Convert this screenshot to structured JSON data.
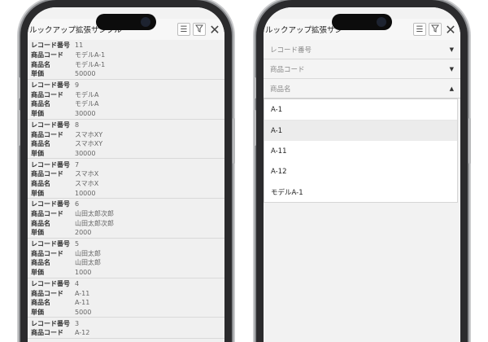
{
  "app": {
    "title": "ルックアップ拡張サンプル",
    "title_right": "ルックアップ拡張サン"
  },
  "toolbar": {
    "sort_icon": "sort-icon",
    "filter_icon": "filter-icon",
    "close_icon": "close-icon",
    "sort_glyph": "☰",
    "filter_glyph": "⏚",
    "close_glyph": "✕"
  },
  "labels": {
    "record_no": "レコード番号",
    "product_code": "商品コード",
    "product_name": "商品名",
    "price": "単価"
  },
  "records": [
    {
      "record_no": "11",
      "product_code": "モデルA-1",
      "product_name": "モデルA-1",
      "price": "50000"
    },
    {
      "record_no": "9",
      "product_code": "モデルA",
      "product_name": "モデルA",
      "price": "30000"
    },
    {
      "record_no": "8",
      "product_code": "スマホXY",
      "product_name": "スマホXY",
      "price": "30000"
    },
    {
      "record_no": "7",
      "product_code": "スマホX",
      "product_name": "スマホX",
      "price": "10000"
    },
    {
      "record_no": "6",
      "product_code": "山田太郎次郎",
      "product_name": "山田太郎次郎",
      "price": "2000"
    },
    {
      "record_no": "5",
      "product_code": "山田太郎",
      "product_name": "山田太郎",
      "price": "1000"
    },
    {
      "record_no": "4",
      "product_code": "A-11",
      "product_name": "A-11",
      "price": "5000"
    },
    {
      "record_no": "3",
      "product_code": "A-12",
      "product_name": "",
      "price": ""
    }
  ],
  "filters": {
    "record_no_placeholder": "レコード番号",
    "product_code_placeholder": "商品コード",
    "product_name_placeholder": "商品名",
    "search_value": "A-1",
    "options": [
      "A-1",
      "A-11",
      "A-12",
      "モデルA-1"
    ]
  },
  "colors": {
    "frame": "#2b2b2d",
    "highlight": "#ececec"
  }
}
